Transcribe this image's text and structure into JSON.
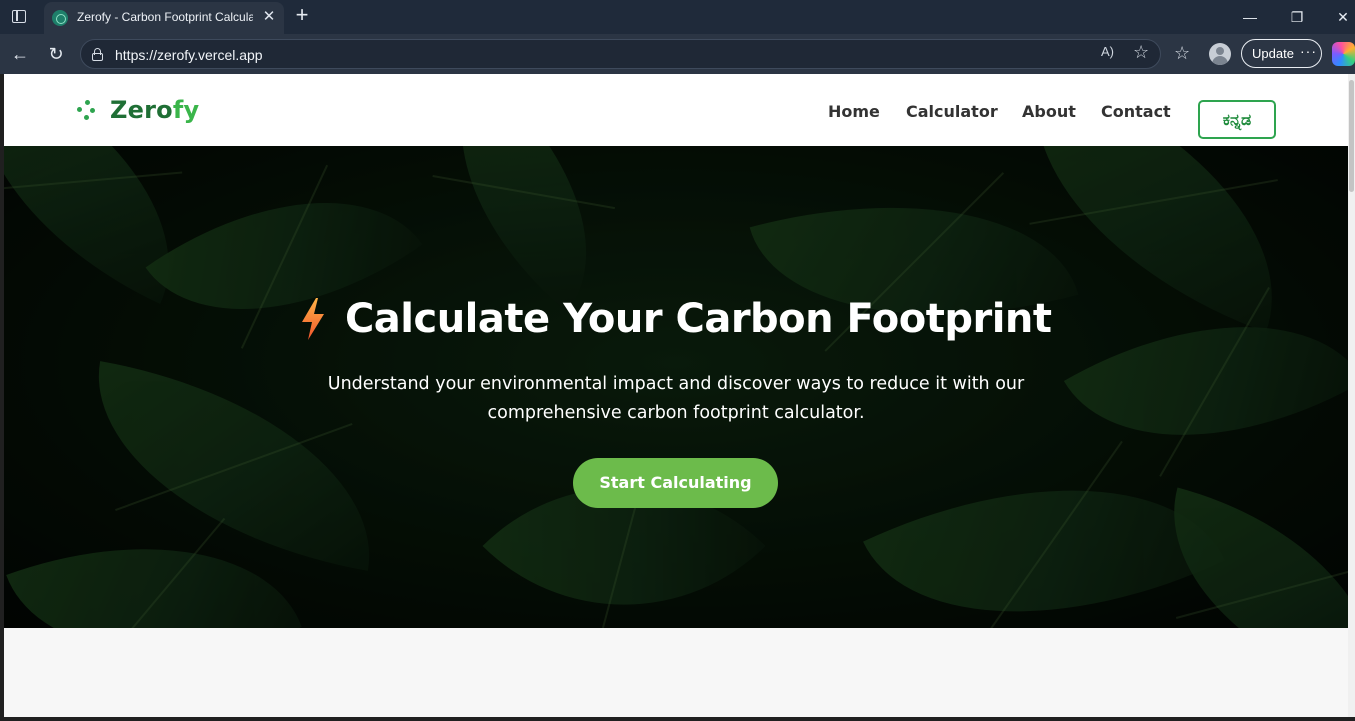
{
  "browser": {
    "tab_title": "Zerofy - Carbon Footprint Calculator",
    "tab_close": "✕",
    "new_tab": "+",
    "window_controls": {
      "minimize": "—",
      "restore": "❐",
      "close": "✕"
    },
    "back": "←",
    "reload": "↻",
    "url": "https://zerofy.vercel.app",
    "read_aloud": "A)",
    "favorite": "☆",
    "favorites": "☆",
    "update_label": "Update",
    "more": "···"
  },
  "site": {
    "logo_main": "Zero",
    "logo_accent": "fy",
    "nav": {
      "home": "Home",
      "calculator": "Calculator",
      "about": "About",
      "contact": "Contact",
      "language": "ಕನ್ನಡ"
    },
    "hero": {
      "title": "Calculate Your Carbon Footprint",
      "subtitle": "Understand your environmental impact and discover ways to reduce it with our comprehensive carbon footprint calculator.",
      "cta": "Start Calculating"
    }
  },
  "colors": {
    "brand_green": "#2ea44f",
    "cta_green": "#6cbb4b",
    "bolt_orange": "#ff7a2f"
  }
}
